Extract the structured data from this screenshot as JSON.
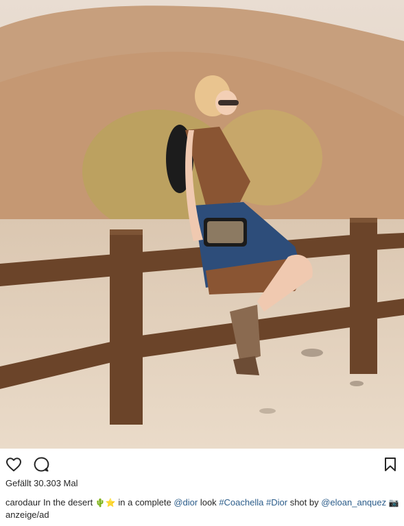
{
  "post": {
    "likes_text": "Gefällt 30.303 Mal",
    "caption": {
      "username": "carodaur",
      "text_1": "In the desert",
      "emoji_cactus": "🌵",
      "emoji_star": "⭐",
      "emoji_box": "",
      "text_2": "in a complete",
      "mention_1": "@dior",
      "text_3": "look",
      "hashtag_1": "#Coachella",
      "hashtag_2": "#Dior",
      "text_4": "shot by",
      "mention_2": "@eloan_anquez",
      "emoji_camera": "📷",
      "ad_label": "anzeige/ad"
    }
  },
  "icons": {
    "like": "heart-icon",
    "comment": "comment-icon",
    "save": "bookmark-icon"
  },
  "colors": {
    "text": "#262626",
    "link": "#2b5c8a",
    "sky": "#d9c9b6",
    "sand": "#e4d4c1",
    "fence": "#5a3a22"
  }
}
